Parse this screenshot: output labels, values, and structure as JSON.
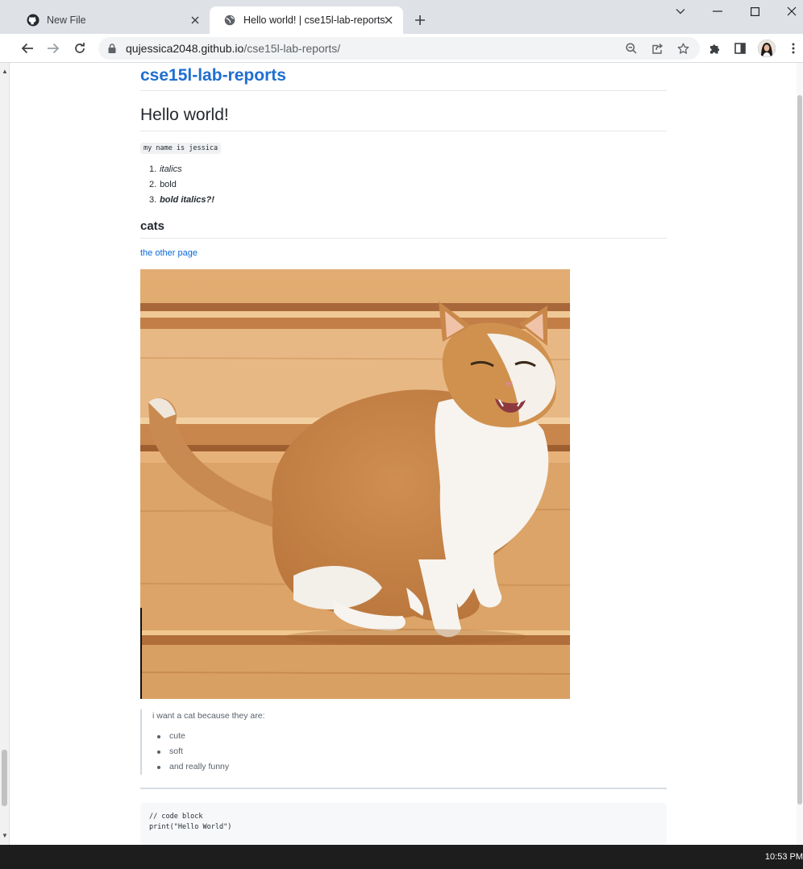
{
  "browser": {
    "tabs": [
      {
        "title": "New File",
        "icon": "github-icon",
        "active": false
      },
      {
        "title": "Hello world! | cse15l-lab-reports",
        "icon": "globe-icon",
        "active": true
      }
    ],
    "address_bar": {
      "host": "qujessica2048.github.io",
      "path": "/cse15l-lab-reports/"
    }
  },
  "page": {
    "site_title": "cse15l-lab-reports",
    "heading": "Hello world!",
    "inline_code": "my name is jessica",
    "ordered_list": [
      {
        "num": "1.",
        "text": "italics"
      },
      {
        "num": "2.",
        "text": "bold"
      },
      {
        "num": "3.",
        "text": "bold italics?!"
      }
    ],
    "subheading": "cats",
    "link_text": "the other page",
    "blockquote": {
      "text": "i want a cat because they are:",
      "items": [
        "cute",
        "soft",
        "and really funny"
      ]
    },
    "code_block": "// code block\nprint(\"Hello World\")"
  },
  "taskbar": {
    "clock": "10:53 PM"
  },
  "colors": {
    "link": "#0969da",
    "site_title": "#1f6fd1",
    "tabstrip": "#dee1e6"
  }
}
